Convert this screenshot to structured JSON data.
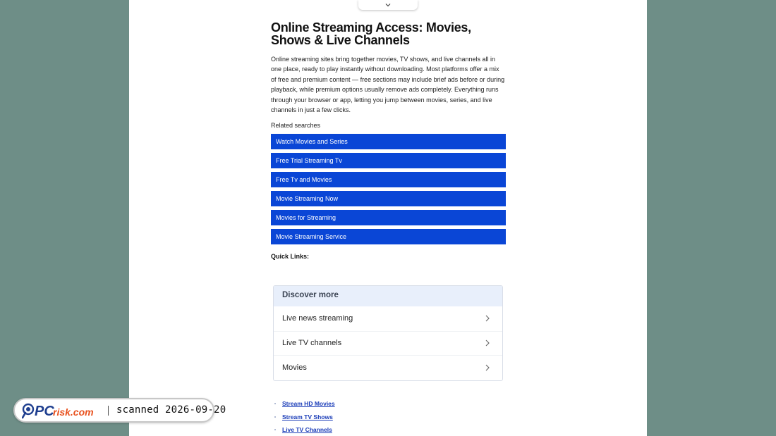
{
  "article": {
    "title": "Online Streaming Access: Movies, Shows & Live Channels",
    "intro": "Online streaming sites bring together movies, TV shows, and live channels all in one place, ready to play instantly without downloading. Most platforms offer a mix of free and premium content — free sections may include brief ads before or during playback, while premium options usually remove ads completely. Everything runs through your browser or app, letting you jump between movies, series, and live channels in just a few clicks.",
    "related_title": "Related searches",
    "related": [
      "Watch Movies and Series",
      "Free Trial Streaming Tv",
      "Free Tv and Movies",
      "Movie Streaming Now",
      "Movies for Streaming",
      "Movie Streaming Service"
    ],
    "quick_links_title": "Quick Links:"
  },
  "discover": {
    "title": "Discover more",
    "items": [
      "Live news streaming",
      "Live TV channels",
      "Movies"
    ]
  },
  "links": [
    "Stream HD Movies",
    "Stream TV Shows",
    "Live TV Channels"
  ],
  "badge": {
    "logo_text": "PCrisk.com",
    "scan_text": "scanned 2026-09-20"
  },
  "colors": {
    "background": "#6e8e87",
    "button": "#0a46d6",
    "link": "#1a3cb8",
    "discover_header": "#e8effb"
  },
  "icons": {
    "collapse": "chevron-down-icon",
    "discover_item": "chevron-right-icon",
    "logo": "magnifier-icon"
  }
}
